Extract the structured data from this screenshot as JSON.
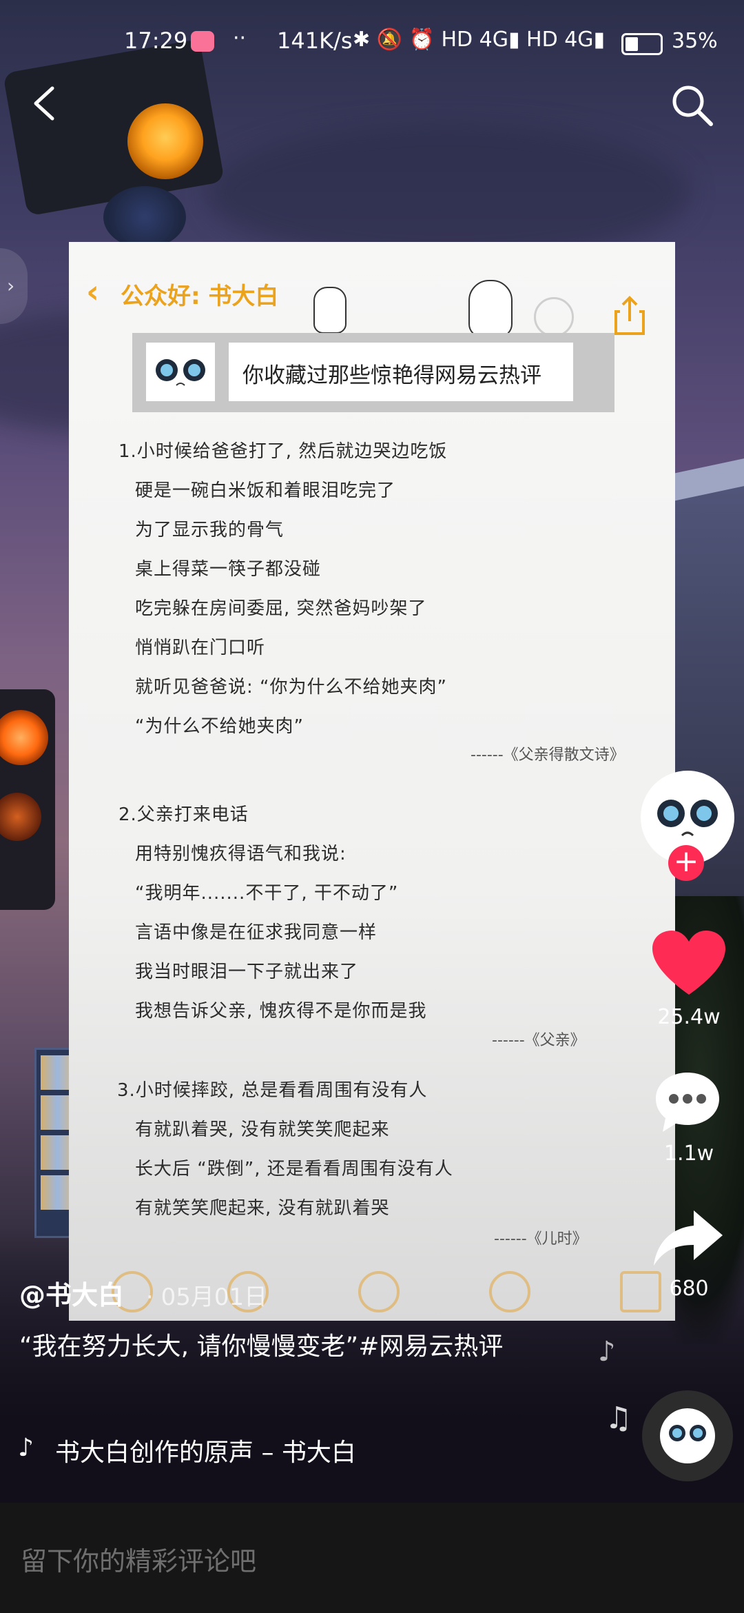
{
  "status_bar": {
    "time": "17:29",
    "app_icon": "bilibili-icon",
    "dots": "··",
    "speed": "141K/s",
    "icons": "✱ 🔕 ⏰ HD 4G▮ HD 4G▮",
    "battery": "35%"
  },
  "nav": {
    "back_icon": "chevron-left-icon",
    "search_icon": "search-icon",
    "side_tab_glyph": "›"
  },
  "card": {
    "back_glyph": "‹",
    "title": "公众好: 书大白",
    "banner": "你收藏过那些惊艳得网易云热评",
    "poems": [
      {
        "lines": [
          "1.小时候给爸爸打了, 然后就边哭边吃饭",
          "硬是一碗白米饭和着眼泪吃完了",
          "为了显示我的骨气",
          "桌上得菜一筷子都没碰",
          "吃完躲在房间委屈, 突然爸妈吵架了",
          "悄悄趴在门口听",
          "就听见爸爸说: “你为什么不给她夹肉”",
          "“为什么不给她夹肉”"
        ],
        "source": "------《父亲得散文诗》"
      },
      {
        "lines": [
          "2.父亲打来电话",
          "用特别愧疚得语气和我说:",
          "“我明年.......不干了, 干不动了”",
          "言语中像是在征求我同意一样",
          "我当时眼泪一下子就出来了",
          "我想告诉父亲, 愧疚得不是你而是我"
        ],
        "source": "------《父亲》"
      },
      {
        "lines": [
          "3.小时候摔跤, 总是看看周围有没有人",
          "有就趴着哭, 没有就笑笑爬起来",
          "长大后 “跌倒”, 还是看看周围有没有人",
          "有就笑笑爬起来, 没有就趴着哭"
        ],
        "source": "------《儿时》"
      }
    ]
  },
  "actions": {
    "follow": "+",
    "likes": "25.4w",
    "comments": "1.1w",
    "shares": "680"
  },
  "video": {
    "author": "@书大白",
    "date": "· 05月01日",
    "caption": "“我在努力长大, 请你慢慢变老”#网易云热评",
    "music_icon": "♪",
    "music": "书大白创作的原声 – 书大白",
    "note_glyph": "♪",
    "note_glyph2": "♫"
  },
  "comment_bar": {
    "placeholder": "留下你的精彩评论吧"
  },
  "colors": {
    "accent": "#fe2c55",
    "notes_yellow": "#eba31e"
  }
}
